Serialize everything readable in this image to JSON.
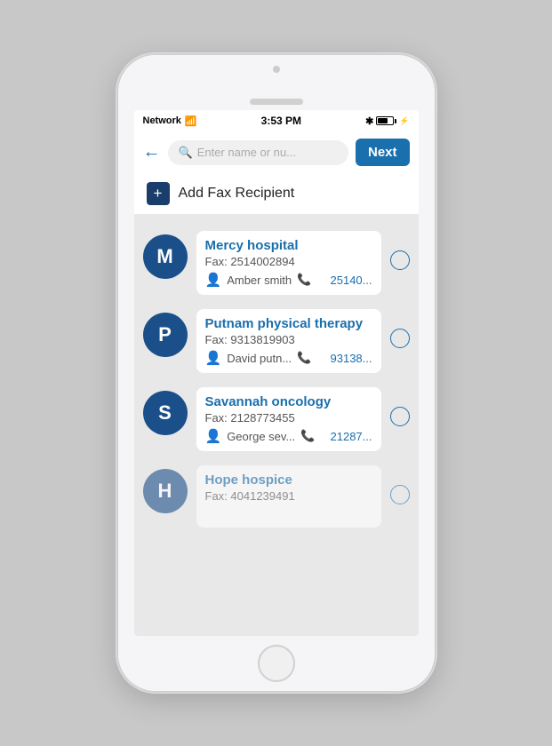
{
  "statusBar": {
    "network": "Network",
    "time": "3:53 PM",
    "bluetooth": "✱",
    "battery_pct": 70
  },
  "searchBar": {
    "placeholder": "Enter name or nu...",
    "backArrow": "←",
    "nextLabel": "Next"
  },
  "addRecipient": {
    "icon": "+",
    "label": "Add Fax Recipient"
  },
  "contacts": [
    {
      "initial": "M",
      "name": "Mercy hospital",
      "fax": "Fax: 2514002894",
      "person": "Amber smith",
      "phone": "25140..."
    },
    {
      "initial": "P",
      "name": "Putnam physical therapy",
      "fax": "Fax: 9313819903",
      "person": "David putn...",
      "phone": "93138..."
    },
    {
      "initial": "S",
      "name": "Savannah oncology",
      "fax": "Fax: 2128773455",
      "person": "George sev...",
      "phone": "21287..."
    },
    {
      "initial": "H",
      "name": "Hope hospice",
      "fax": "Fax: 4041239491",
      "person": "",
      "phone": ""
    }
  ]
}
